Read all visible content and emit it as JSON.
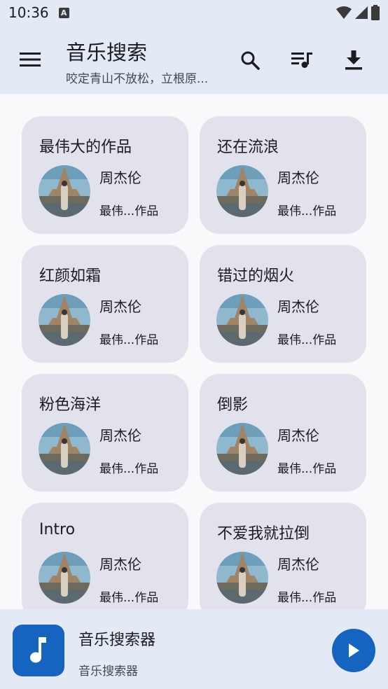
{
  "status": {
    "time": "10:36",
    "a_badge": "A"
  },
  "header": {
    "title": "音乐搜索",
    "subtitle": "咬定青山不放松，立根原...",
    "icons": [
      "menu-icon",
      "search-icon",
      "playlist-icon",
      "download-icon"
    ]
  },
  "songs": [
    {
      "title": "最伟大的作品",
      "artist": "周杰伦",
      "album": "最伟...作品"
    },
    {
      "title": "还在流浪",
      "artist": "周杰伦",
      "album": "最伟...作品"
    },
    {
      "title": "红颜如霜",
      "artist": "周杰伦",
      "album": "最伟...作品"
    },
    {
      "title": "错过的烟火",
      "artist": "周杰伦",
      "album": "最伟...作品"
    },
    {
      "title": "粉色海洋",
      "artist": "周杰伦",
      "album": "最伟...作品"
    },
    {
      "title": "倒影",
      "artist": "周杰伦",
      "album": "最伟...作品"
    },
    {
      "title": "Intro",
      "artist": "周杰伦",
      "album": "最伟...作品"
    },
    {
      "title": "不爱我就拉倒",
      "artist": "周杰伦",
      "album": "最伟...作品"
    }
  ],
  "player": {
    "title": "音乐搜索器",
    "subtitle": "音乐搜索器"
  },
  "colors": {
    "accent": "#1565c0",
    "bar": "#e3e9f5",
    "card": "#e1e2ec"
  }
}
